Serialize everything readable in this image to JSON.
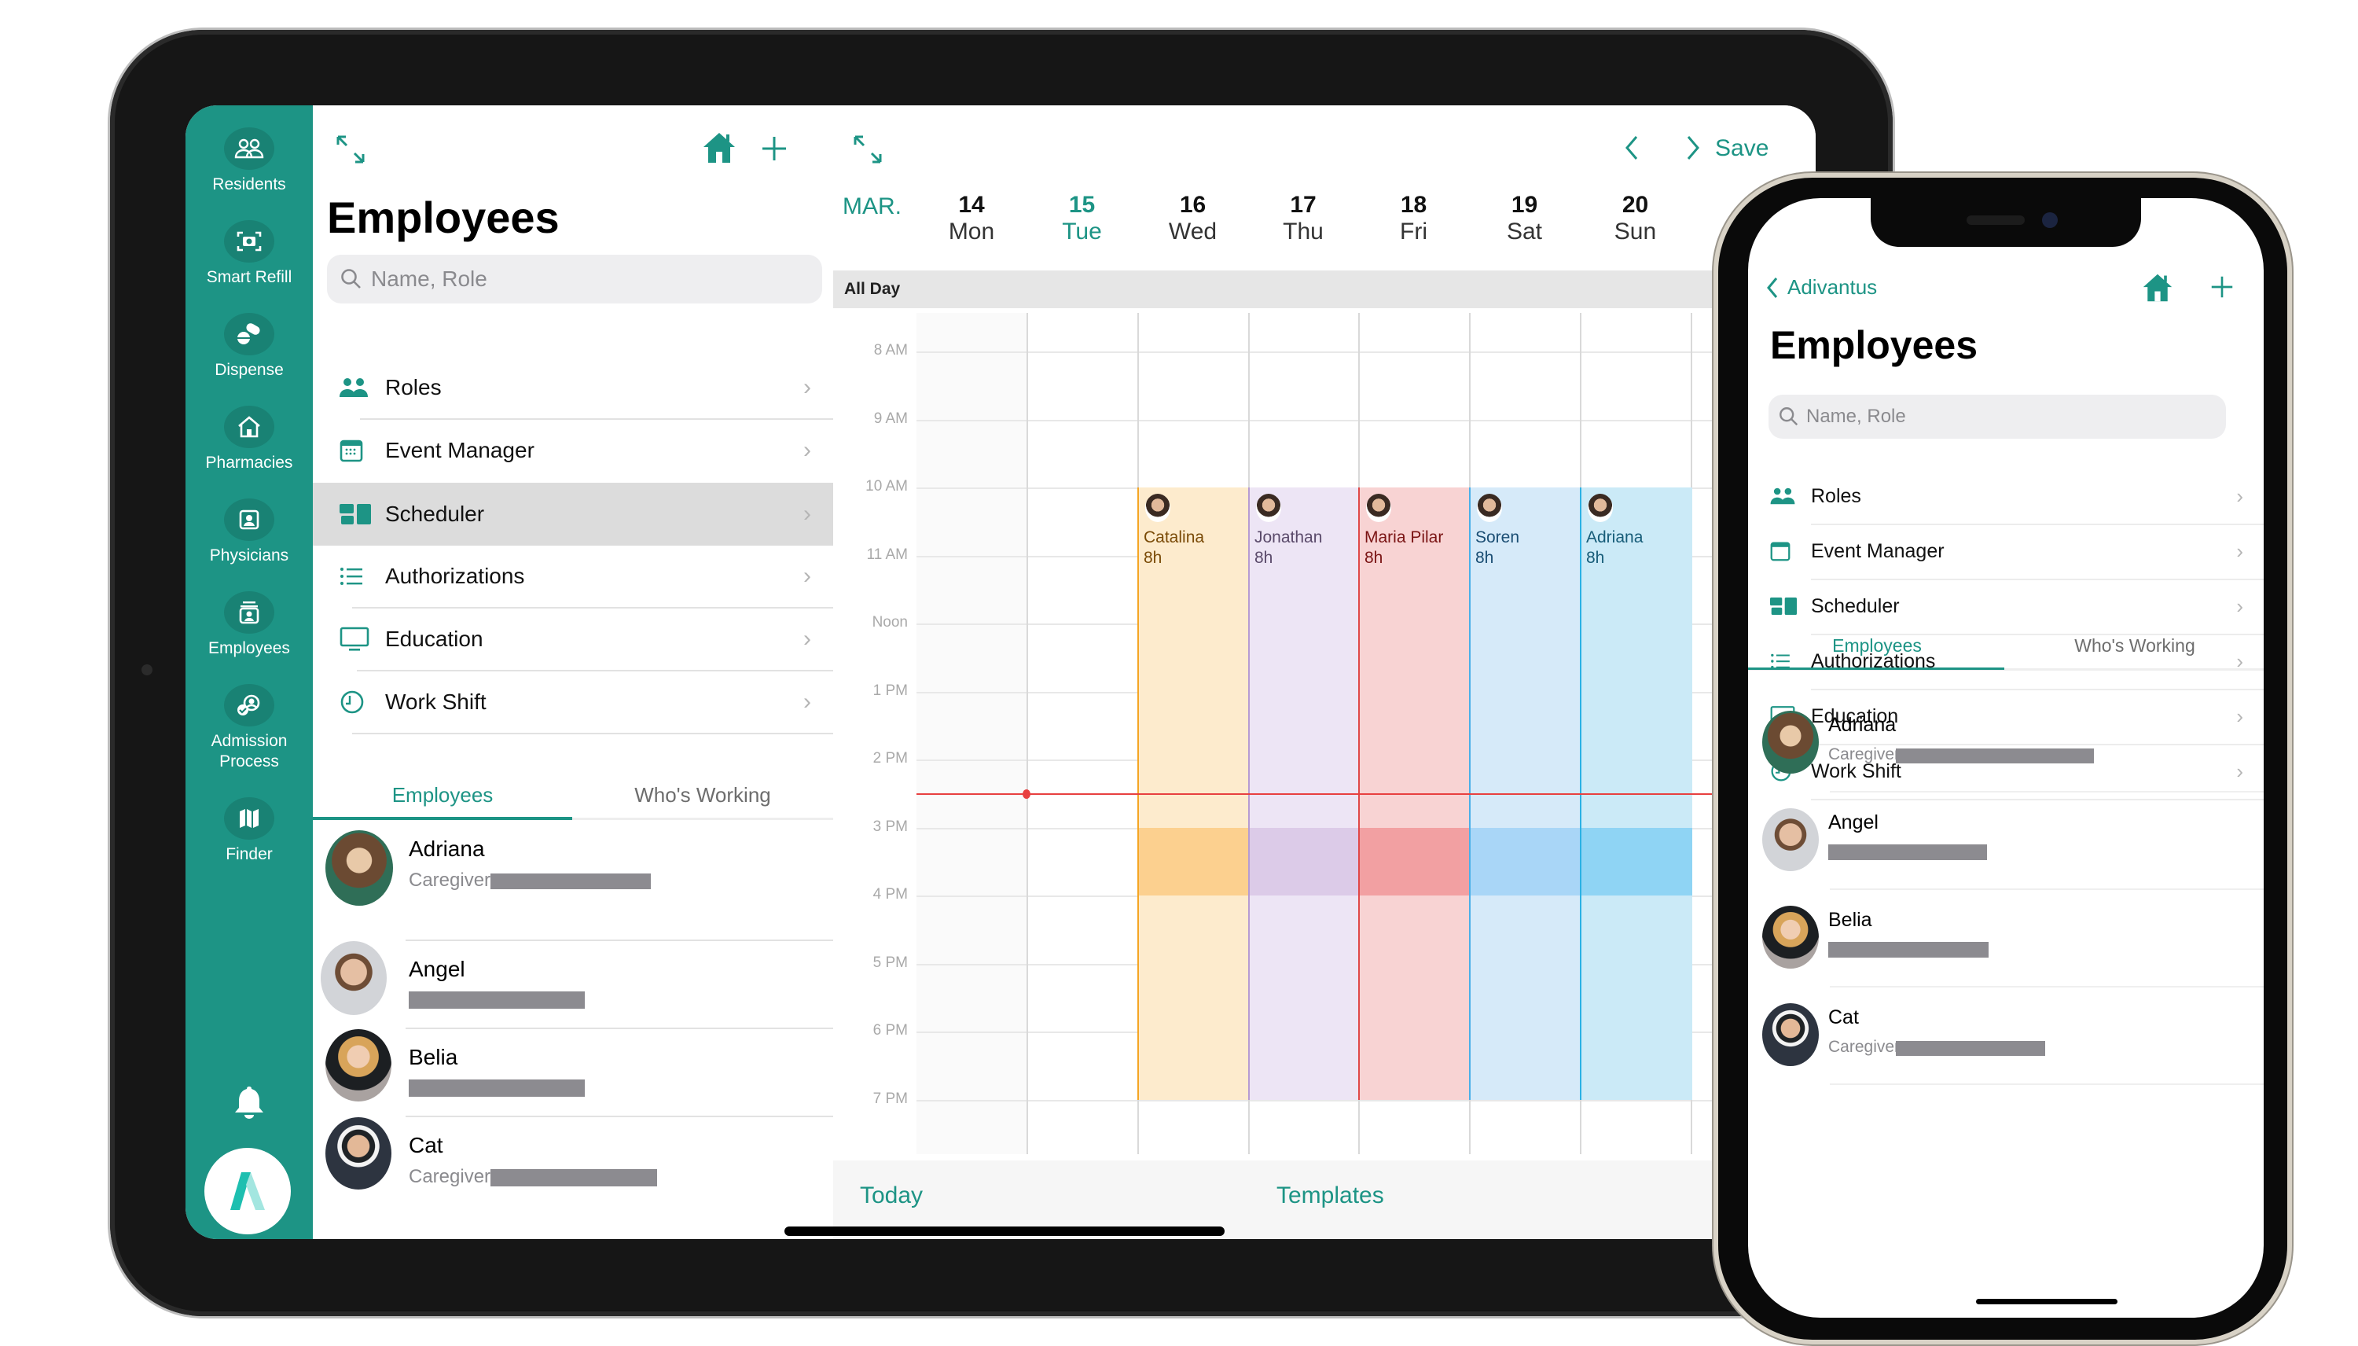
{
  "ipad": {
    "sidebar": {
      "items": [
        {
          "label": "Residents",
          "icon": "people-icon"
        },
        {
          "label": "Smart Refill",
          "icon": "camera-scan-icon"
        },
        {
          "label": "Dispense",
          "icon": "pills-icon"
        },
        {
          "label": "Pharmacies",
          "icon": "house-icon"
        },
        {
          "label": "Physicians",
          "icon": "id-card-icon"
        },
        {
          "label": "Employees",
          "icon": "badge-icon"
        },
        {
          "label": "Admission Process",
          "label_line1": "Admission",
          "label_line2": "Process",
          "icon": "person-check-icon"
        },
        {
          "label": "Finder",
          "icon": "map-icon"
        }
      ],
      "bell_icon": "bell-icon",
      "logo_icon": "adivantus-logo"
    },
    "left_panel": {
      "title": "Employees",
      "search_placeholder": "Name, Role",
      "menu": [
        {
          "label": "Roles",
          "icon": "people-icon",
          "selected": false
        },
        {
          "label": "Event Manager",
          "icon": "calendar-icon",
          "selected": false
        },
        {
          "label": "Scheduler",
          "icon": "scheduler-icon",
          "selected": true
        },
        {
          "label": "Authorizations",
          "icon": "list-icon",
          "selected": false
        },
        {
          "label": "Education",
          "icon": "monitor-icon",
          "selected": false
        },
        {
          "label": "Work Shift",
          "icon": "clock-icon",
          "selected": false
        }
      ],
      "tabs": [
        {
          "label": "Employees",
          "active": true
        },
        {
          "label": "Who's Working",
          "active": false
        }
      ],
      "employees": [
        {
          "name": "Adriana",
          "role": "Caregiver",
          "separator": "•"
        },
        {
          "name": "Angel",
          "role": ""
        },
        {
          "name": "Belia",
          "role": ""
        },
        {
          "name": "Cat",
          "role": "Caregiver",
          "separator": "•"
        }
      ]
    },
    "calendar": {
      "month": "MAR.",
      "save_label": "Save",
      "days": [
        {
          "num": "14",
          "name": "Mon",
          "today": false
        },
        {
          "num": "15",
          "name": "Tue",
          "today": true
        },
        {
          "num": "16",
          "name": "Wed",
          "today": false
        },
        {
          "num": "17",
          "name": "Thu",
          "today": false
        },
        {
          "num": "18",
          "name": "Fri",
          "today": false
        },
        {
          "num": "19",
          "name": "Sat",
          "today": false
        },
        {
          "num": "20",
          "name": "Sun",
          "today": false
        }
      ],
      "all_day_label": "All Day",
      "hours": [
        "8 AM",
        "9 AM",
        "10 AM",
        "11 AM",
        "Noon",
        "1 PM",
        "2 PM",
        "3 PM",
        "4 PM",
        "5 PM",
        "6 PM",
        "7 PM"
      ],
      "now_time_hours": 14.5,
      "shifts": [
        {
          "name": "Catalina",
          "duration": "8h",
          "day_index": 2,
          "start": 10,
          "end": 19,
          "highlight_start": 15,
          "highlight_end": 16,
          "bg": "#fdebcd",
          "strong": "#fcd08f",
          "accent": "#f5a623",
          "text": "#7a4a07"
        },
        {
          "name": "Jonathan",
          "duration": "8h",
          "day_index": 3,
          "start": 10,
          "end": 19,
          "highlight_start": 15,
          "highlight_end": 16,
          "bg": "#ede5f5",
          "strong": "#dccbe8",
          "accent": "#b79bd2",
          "text": "#5a4a6a"
        },
        {
          "name": "Maria Pilar",
          "duration": "8h",
          "day_index": 4,
          "start": 10,
          "end": 19,
          "highlight_start": 15,
          "highlight_end": 16,
          "bg": "#f8d3d3",
          "strong": "#f2a0a2",
          "accent": "#e04848",
          "text": "#7a1414"
        },
        {
          "name": "Soren",
          "duration": "8h",
          "day_index": 5,
          "start": 10,
          "end": 19,
          "highlight_start": 15,
          "highlight_end": 16,
          "bg": "#d6eaf9",
          "strong": "#a9d6f7",
          "accent": "#4ab0e8",
          "text": "#1a4d73"
        },
        {
          "name": "Adriana",
          "duration": "8h",
          "day_index": 6,
          "start": 10,
          "end": 19,
          "highlight_start": 15,
          "highlight_end": 16,
          "bg": "#cbeaf7",
          "strong": "#8fd4f4",
          "accent": "#2bb1e4",
          "text": "#165c78"
        }
      ],
      "footer": {
        "today_label": "Today",
        "templates_label": "Templates"
      }
    }
  },
  "phone": {
    "back_label": "Adivantus",
    "title": "Employees",
    "search_placeholder": "Name, Role",
    "menu": [
      {
        "label": "Roles",
        "icon": "people-icon"
      },
      {
        "label": "Event Manager",
        "icon": "calendar-icon"
      },
      {
        "label": "Scheduler",
        "icon": "scheduler-icon"
      },
      {
        "label": "Authorizations",
        "icon": "list-icon"
      },
      {
        "label": "Education",
        "icon": "monitor-icon"
      },
      {
        "label": "Work Shift",
        "icon": "clock-icon"
      }
    ],
    "tabs": [
      {
        "label": "Employees",
        "active": true
      },
      {
        "label": "Who's Working",
        "active": false
      }
    ],
    "employees": [
      {
        "name": "Adriana",
        "role": "Caregiver",
        "separator": "•"
      },
      {
        "name": "Angel",
        "role": ""
      },
      {
        "name": "Belia",
        "role": ""
      },
      {
        "name": "Cat",
        "role": "Caregiver",
        "separator": "•"
      }
    ]
  },
  "colors": {
    "brand": "#1d9485",
    "brand_dark": "#198274",
    "now_line": "#e84040",
    "selected_row": "#dcdcdc"
  }
}
